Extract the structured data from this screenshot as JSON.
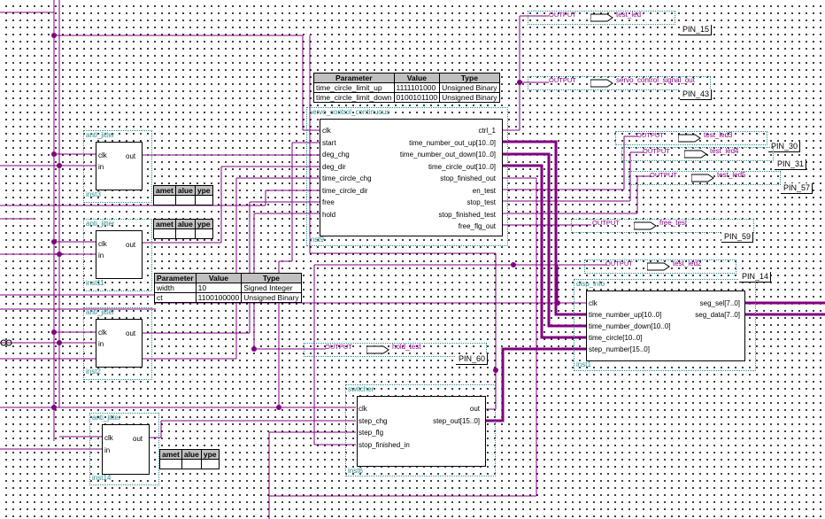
{
  "blocks": {
    "servo": {
      "title": "servo_control_continuous",
      "inst": "inst9",
      "left_ports": [
        "clk",
        "start",
        "deg_chg",
        "deg_dir",
        "time_circle_chg",
        "time_circle_dir",
        "free",
        "hold"
      ],
      "right_ports": [
        "ctrl_1",
        "time_number_out_up[10..0]",
        "time_number_out_down[10..0]",
        "time_circle_out[10..0]",
        "stop_finished_out",
        "en_test",
        "stop_test",
        "stop_finished_test",
        "free_flg_out"
      ]
    },
    "aj3": {
      "title": "anti_jitter",
      "inst": "inst3",
      "ports_in": [
        "clk",
        "in"
      ],
      "port_out": "out"
    },
    "aj11": {
      "title": "anti_jitter",
      "inst": "inst11",
      "ports_in": [
        "clk",
        "in"
      ],
      "port_out": "out"
    },
    "aj2": {
      "title": "anti_jitter",
      "inst": "inst2",
      "ports_in": [
        "clk",
        "in"
      ],
      "port_out": "out"
    },
    "aj14": {
      "title": "anti_jitter",
      "inst": "inst14",
      "ports_in": [
        "clk",
        "in"
      ],
      "port_out": "out"
    },
    "disp": {
      "title": "disp_info",
      "inst": "inst1",
      "left_ports": [
        "clk",
        "time_number_up[10..0]",
        "time_number_down[10..0]",
        "time_circle[10..0]",
        "step_number[15..0]"
      ],
      "right_ports": [
        "seg_sel[7..0]",
        "seg_data[7..0]"
      ]
    },
    "sw": {
      "title": "switcher",
      "inst": "inst6",
      "left_ports": [
        "clk",
        "step_chg",
        "step_flg",
        "stop_finished_in"
      ],
      "right_ports": [
        "out",
        "step_out[15..0]"
      ]
    }
  },
  "tables": {
    "servo_params": {
      "headers": [
        "Parameter",
        "Value",
        "Type"
      ],
      "rows": [
        [
          "time_circle_limit_up",
          "1111101000",
          "Unsigned Binary"
        ],
        [
          "time_circle_limit_down",
          "0100101100",
          "Unsigned Binary"
        ]
      ]
    },
    "aj_params": {
      "headers": [
        "Parameter",
        "Value",
        "Type"
      ],
      "rows": [
        [
          "width",
          "10",
          "Signed Integer"
        ],
        [
          "ct",
          "1100100000",
          "Unsigned Binary"
        ]
      ]
    },
    "small_header": [
      "amet",
      "alue",
      "ype"
    ]
  },
  "outputs": [
    {
      "tag": "OUTPUT",
      "name": "test_led",
      "pin": "PIN_15"
    },
    {
      "tag": "OUTPUT",
      "name": "servo_control_signal_out",
      "pin": "PIN_43"
    },
    {
      "tag": "OUTPUT",
      "name": "test_led3",
      "pin": "PIN_30"
    },
    {
      "tag": "OUTPUT",
      "name": "test_led4",
      "pin": "PIN_31"
    },
    {
      "tag": "OUTPUT",
      "name": "test_led5",
      "pin": "PIN_57"
    },
    {
      "tag": "OUTPUT",
      "name": "free_test",
      "pin": "PIN_59"
    },
    {
      "tag": "OUTPUT",
      "name": "test_led2",
      "pin": "PIN_14"
    },
    {
      "tag": "OUTPUT",
      "name": "hold_test",
      "pin": "PIN_60"
    }
  ],
  "colors": {
    "wire": "#800080",
    "block_border": "#2e8b8b",
    "header_bg": "#c0c0c0"
  }
}
